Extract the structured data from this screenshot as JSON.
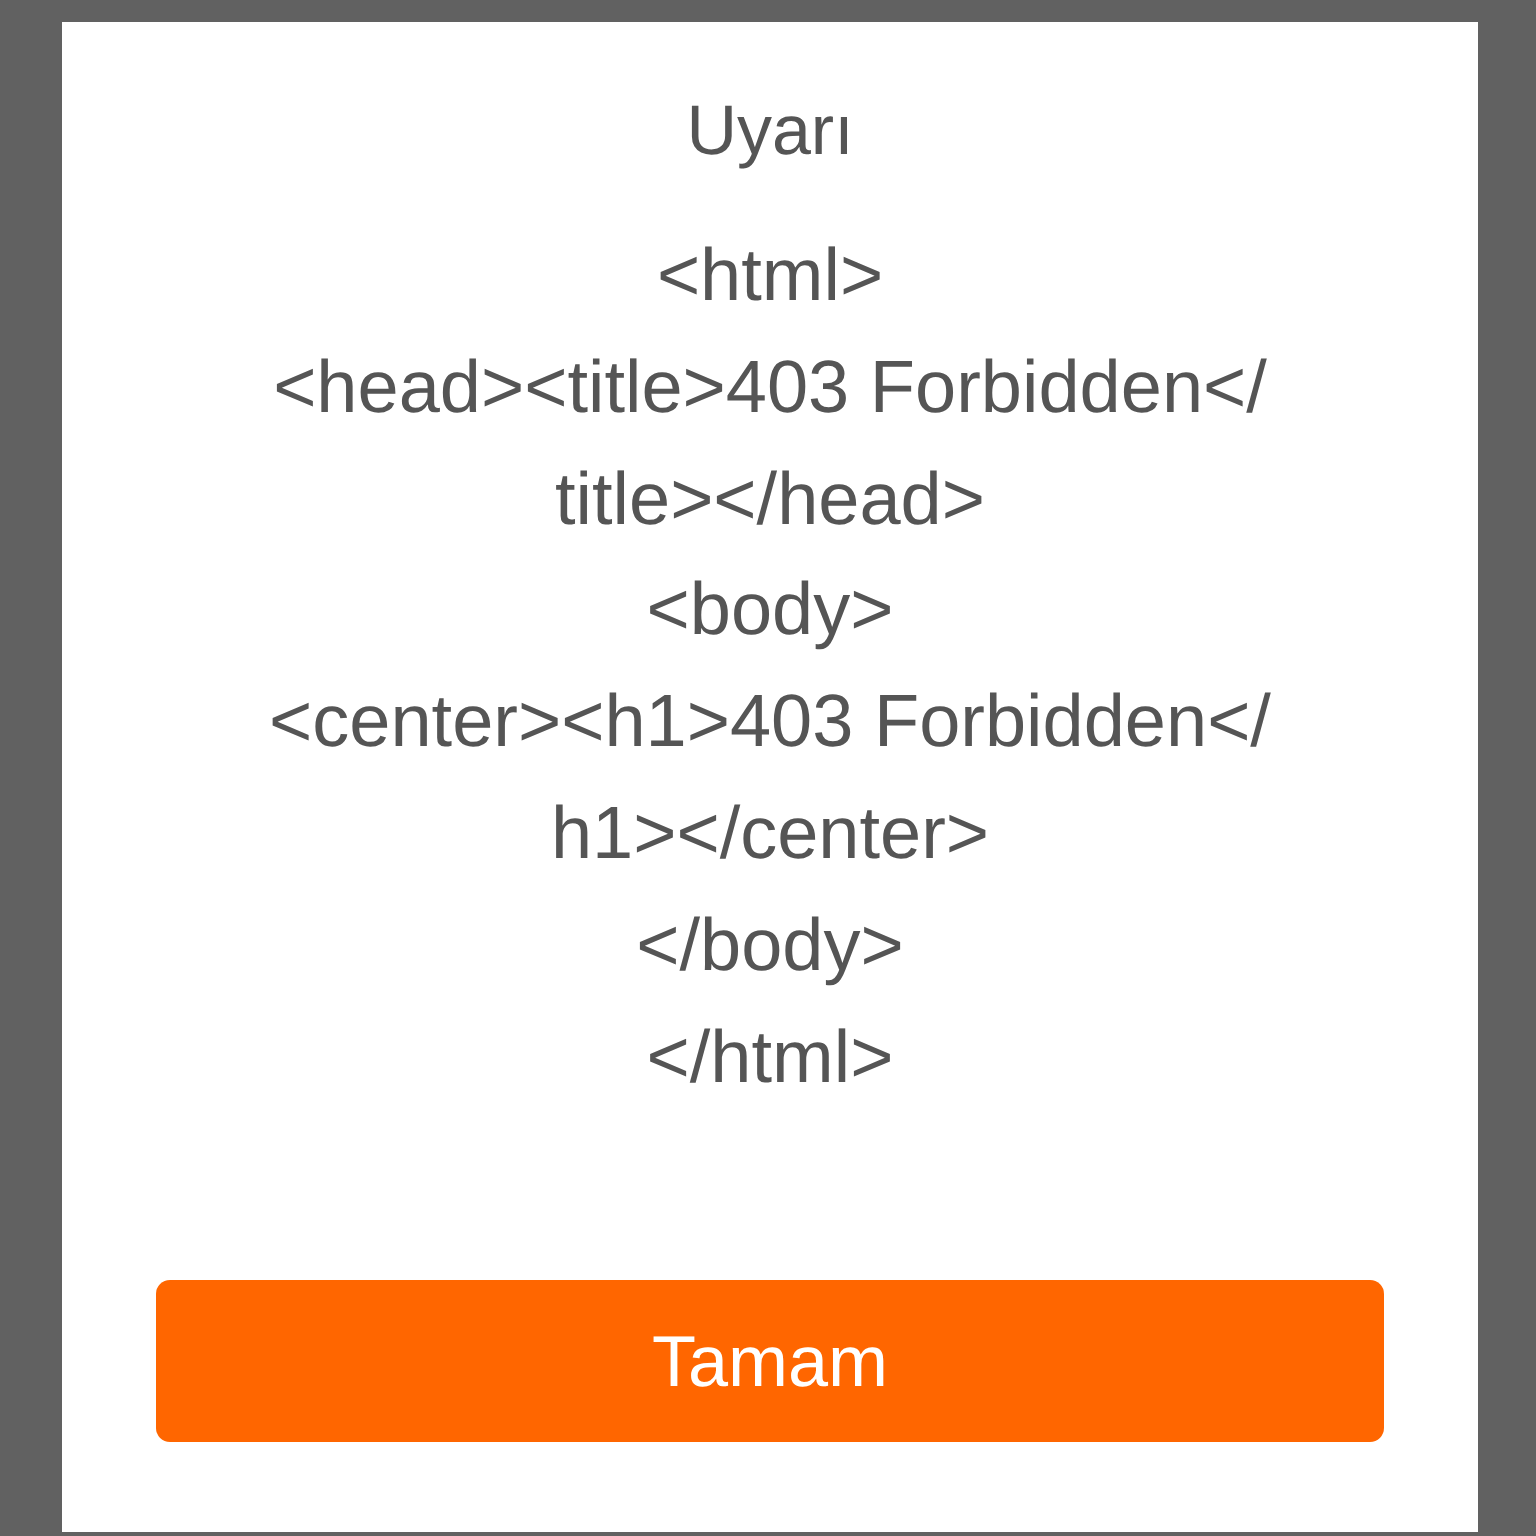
{
  "dialog": {
    "title": "Uyarı",
    "message": "<html>\n<head><title>403 Forbidden</\ntitle></head>\n<body>\n<center><h1>403 Forbidden</\nh1></center>\n</body>\n</html>",
    "button": {
      "label": "Tamam"
    }
  }
}
